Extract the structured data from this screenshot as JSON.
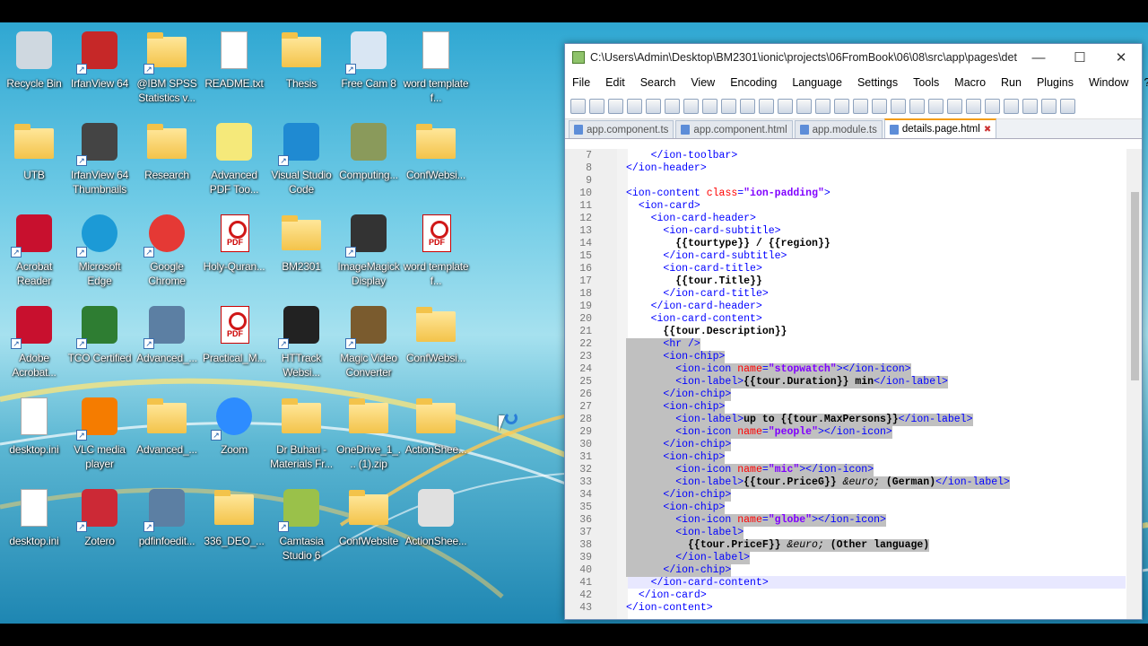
{
  "desktop": {
    "icons": [
      {
        "label": "Recycle Bin",
        "icon": "recycle-bin-icon"
      },
      {
        "label": "IrfanView 64",
        "icon": "irfanview-icon"
      },
      {
        "label": "@IBM SPSS Statistics v...",
        "icon": "folder-icon"
      },
      {
        "label": "README.txt",
        "icon": "text-file-icon"
      },
      {
        "label": "Thesis",
        "icon": "folder-icon"
      },
      {
        "label": "Free Cam 8",
        "icon": "free-cam-icon"
      },
      {
        "label": "word template f...",
        "icon": "word-doc-icon"
      },
      {
        "label": "UTB",
        "icon": "folder-icon"
      },
      {
        "label": "IrfanView 64 Thumbnails",
        "icon": "irfanview-thumbnails-icon"
      },
      {
        "label": "Research",
        "icon": "folder-icon"
      },
      {
        "label": "Advanced PDF Too...",
        "icon": "pdf-tools-icon"
      },
      {
        "label": "Visual Studio Code",
        "icon": "vscode-icon"
      },
      {
        "label": "Computing...",
        "icon": "film-icon"
      },
      {
        "label": "ConfWebsi...",
        "icon": "chrome-folder-icon"
      },
      {
        "label": "Acrobat Reader",
        "icon": "acrobat-icon"
      },
      {
        "label": "Microsoft Edge",
        "icon": "edge-icon"
      },
      {
        "label": "Google Chrome",
        "icon": "chrome-icon"
      },
      {
        "label": "Holy-Quran...",
        "icon": "pdf-file-icon"
      },
      {
        "label": "BM2301",
        "icon": "folder-icon"
      },
      {
        "label": "ImageMagick Display",
        "icon": "imagemagick-icon"
      },
      {
        "label": "word template f...",
        "icon": "pdf-file-icon"
      },
      {
        "label": "Adobe Acrobat...",
        "icon": "acrobat-icon"
      },
      {
        "label": "TCO Certified",
        "icon": "tco-icon"
      },
      {
        "label": "Advanced_...",
        "icon": "installer-icon"
      },
      {
        "label": "Practical_M...",
        "icon": "pdf-file-icon"
      },
      {
        "label": "HTTrack Websi...",
        "icon": "httrack-icon"
      },
      {
        "label": "Magic Video Converter",
        "icon": "video-converter-icon"
      },
      {
        "label": "ConfWebsi...",
        "icon": "zip-folder-icon"
      },
      {
        "label": "desktop.ini",
        "icon": "settings-file-icon"
      },
      {
        "label": "VLC media player",
        "icon": "vlc-icon"
      },
      {
        "label": "Advanced_...",
        "icon": "zip-folder-icon"
      },
      {
        "label": "Zoom",
        "icon": "zoom-icon"
      },
      {
        "label": "Dr Buhari - Materials Fr...",
        "icon": "folder-icon"
      },
      {
        "label": "OneDrive_1_... (1).zip",
        "icon": "zip-folder-icon"
      },
      {
        "label": "ActionShee...",
        "icon": "folder-icon"
      },
      {
        "label": "desktop.ini",
        "icon": "settings-file-icon"
      },
      {
        "label": "Zotero",
        "icon": "zotero-icon"
      },
      {
        "label": "pdfinfoedit...",
        "icon": "installer-icon"
      },
      {
        "label": "336_DEO_...",
        "icon": "zip-folder-icon"
      },
      {
        "label": "Camtasia Studio 6",
        "icon": "camtasia-icon"
      },
      {
        "label": "ConfWebsite",
        "icon": "chrome-folder-icon"
      },
      {
        "label": "ActionShee...",
        "icon": "spreadsheet-icon"
      }
    ]
  },
  "notepad": {
    "title": "C:\\Users\\Admin\\Desktop\\BM2301\\ionic\\projects\\06FromBook\\06\\08\\src\\app\\pages\\det...",
    "window_buttons": {
      "minimize": "—",
      "maximize": "☐",
      "close": "✕"
    },
    "menu": [
      "File",
      "Edit",
      "Search",
      "View",
      "Encoding",
      "Language",
      "Settings",
      "Tools",
      "Macro",
      "Run",
      "Plugins",
      "Window",
      "?"
    ],
    "menu_plus": "+",
    "tabs": [
      {
        "label": "app.component.ts",
        "active": false
      },
      {
        "label": "app.component.html",
        "active": false
      },
      {
        "label": "app.module.ts",
        "active": false
      },
      {
        "label": "details.page.html",
        "active": true
      }
    ],
    "lines": [
      {
        "n": "7",
        "html": "    <span class=\"tag\">&lt;/ion-toolbar&gt;</span>"
      },
      {
        "n": "8",
        "html": "<span class=\"tag\">&lt;/ion-header&gt;</span>"
      },
      {
        "n": "9",
        "html": ""
      },
      {
        "n": "10",
        "html": "<span class=\"tag\">&lt;ion-content</span> <span class=\"at\">class</span><span class=\"tag\">=</span><span class=\"av\">\"ion-padding\"</span><span class=\"tag\">&gt;</span>"
      },
      {
        "n": "11",
        "html": "  <span class=\"tag\">&lt;ion-card&gt;</span>"
      },
      {
        "n": "12",
        "html": "    <span class=\"tag\">&lt;ion-card-header&gt;</span>"
      },
      {
        "n": "13",
        "html": "      <span class=\"tag\">&lt;ion-card-subtitle&gt;</span>"
      },
      {
        "n": "14",
        "html": "        <span class=\"tx\">{{tourtype}} / {{region}}</span>"
      },
      {
        "n": "15",
        "html": "      <span class=\"tag\">&lt;/ion-card-subtitle&gt;</span>"
      },
      {
        "n": "16",
        "html": "      <span class=\"tag\">&lt;ion-card-title&gt;</span>"
      },
      {
        "n": "17",
        "html": "        <span class=\"tx\">{{tour.Title}}</span>"
      },
      {
        "n": "18",
        "html": "      <span class=\"tag\">&lt;/ion-card-title&gt;</span>"
      },
      {
        "n": "19",
        "html": "    <span class=\"tag\">&lt;/ion-card-header&gt;</span>"
      },
      {
        "n": "20",
        "html": "    <span class=\"tag\">&lt;ion-card-content&gt;</span>"
      },
      {
        "n": "21",
        "html": "      <span class=\"tx\">{{tour.Description}}</span>"
      },
      {
        "n": "22",
        "html": "      <span class=\"tag\">&lt;hr /&gt;</span>",
        "sel": true
      },
      {
        "n": "23",
        "html": "      <span class=\"tag\">&lt;ion-chip&gt;</span>",
        "sel": true
      },
      {
        "n": "24",
        "html": "        <span class=\"tag\">&lt;ion-icon</span> <span class=\"at\">name</span><span class=\"tag\">=</span><span class=\"av\">\"stopwatch\"</span><span class=\"tag\">&gt;&lt;/ion-icon&gt;</span>",
        "sel": true
      },
      {
        "n": "25",
        "html": "        <span class=\"tag\">&lt;ion-label&gt;</span><span class=\"tx\">{{tour.Duration}} min</span><span class=\"tag\">&lt;/ion-label&gt;</span>",
        "sel": true
      },
      {
        "n": "26",
        "html": "      <span class=\"tag\">&lt;/ion-chip&gt;</span>",
        "sel": true
      },
      {
        "n": "27",
        "html": "      <span class=\"tag\">&lt;ion-chip&gt;</span>",
        "sel": true
      },
      {
        "n": "28",
        "html": "        <span class=\"tag\">&lt;ion-label&gt;</span><span class=\"tx\">up to {{tour.MaxPersons}}</span><span class=\"tag\">&lt;/ion-label&gt;</span>",
        "sel": true
      },
      {
        "n": "29",
        "html": "        <span class=\"tag\">&lt;ion-icon</span> <span class=\"at\">name</span><span class=\"tag\">=</span><span class=\"av\">\"people\"</span><span class=\"tag\">&gt;&lt;/ion-icon&gt;</span>",
        "sel": true
      },
      {
        "n": "30",
        "html": "      <span class=\"tag\">&lt;/ion-chip&gt;</span>",
        "sel": true
      },
      {
        "n": "31",
        "html": "      <span class=\"tag\">&lt;ion-chip&gt;</span>",
        "sel": true
      },
      {
        "n": "32",
        "html": "        <span class=\"tag\">&lt;ion-icon</span> <span class=\"at\">name</span><span class=\"tag\">=</span><span class=\"av\">\"mic\"</span><span class=\"tag\">&gt;&lt;/ion-icon&gt;</span>",
        "sel": true
      },
      {
        "n": "33",
        "html": "        <span class=\"tag\">&lt;ion-label&gt;</span><span class=\"tx\">{{tour.PriceG}} </span><span class=\"en\">&amp;euro;</span><span class=\"tx\"> (German)</span><span class=\"tag\">&lt;/ion-label&gt;</span>",
        "sel": true
      },
      {
        "n": "34",
        "html": "      <span class=\"tag\">&lt;/ion-chip&gt;</span>",
        "sel": true
      },
      {
        "n": "35",
        "html": "      <span class=\"tag\">&lt;ion-chip&gt;</span>",
        "sel": true
      },
      {
        "n": "36",
        "html": "        <span class=\"tag\">&lt;ion-icon</span> <span class=\"at\">name</span><span class=\"tag\">=</span><span class=\"av\">\"globe\"</span><span class=\"tag\">&gt;&lt;/ion-icon&gt;</span>",
        "sel": true
      },
      {
        "n": "37",
        "html": "        <span class=\"tag\">&lt;ion-label&gt;</span>",
        "sel": true
      },
      {
        "n": "38",
        "html": "          <span class=\"tx\">{{tour.PriceF}} </span><span class=\"en\">&amp;euro;</span><span class=\"tx\"> (Other language)</span>",
        "sel": true
      },
      {
        "n": "39",
        "html": "        <span class=\"tag\">&lt;/ion-label&gt;</span>",
        "sel": true
      },
      {
        "n": "40",
        "html": "      <span class=\"tag\">&lt;/ion-chip&gt;</span>",
        "sel": true
      },
      {
        "n": "41",
        "html": "    <span class=\"tag\">&lt;/ion-card-content&gt;</span>"
      },
      {
        "n": "42",
        "html": "  <span class=\"tag\">&lt;/ion-card&gt;</span>"
      },
      {
        "n": "43",
        "html": "<span class=\"tag\">&lt;/ion-content&gt;</span>"
      }
    ]
  },
  "colors": {
    "tag": "#0000ff",
    "attr": "#ff0000",
    "value": "#8000ff",
    "selection": "#c0c0c0",
    "active_tab_accent": "#f39c12"
  }
}
